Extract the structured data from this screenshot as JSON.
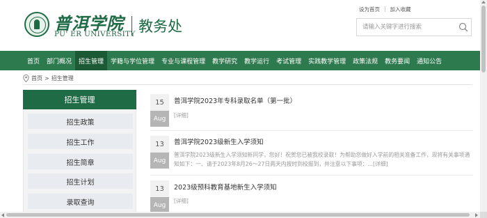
{
  "header": {
    "logo_cn": "普洱学院",
    "logo_en": "PU' ER UNIVERSITY",
    "department": "教务处",
    "logo_icon": "university-seal-icon",
    "top_links": [
      "设为首页",
      "加入收藏"
    ],
    "search_placeholder": "请输入关键字进行搜索",
    "search_icon": "search-icon"
  },
  "nav": {
    "items": [
      "首页",
      "部门概况",
      "招生管理",
      "学籍与学位管理",
      "专业与课程管理",
      "教学研究",
      "教学运行",
      "考试管理",
      "实践教学管理",
      "政策法规",
      "教务要闻",
      "通知公告"
    ],
    "active_index": 2
  },
  "breadcrumb": {
    "icon": "location-pin-icon",
    "home": "首页",
    "separator": ">",
    "current": "招生管理"
  },
  "sidebar": {
    "title": "招生管理",
    "items": [
      "招生政策",
      "招生工作",
      "招生简章",
      "招生计划",
      "录取查询"
    ]
  },
  "news": [
    {
      "day": "15",
      "month": "Aug",
      "title": "普洱学院2023年专科录取名单（第一批）",
      "detail": "[详细]"
    },
    {
      "day": "13",
      "month": "Aug",
      "title": "普洱学院2023级新生入学须知",
      "summary": "普洱学院2023级新生入学须知新同学，您好！祝贺您已被我校录取！为帮助您做好入学前的相关准备工作，现将有关事项通知如下：一、请于2023年8月26～27日两天内按时到校报到，并注意以下事项：...[详细]"
    },
    {
      "day": "13",
      "month": "Aug",
      "title": "2023级预科教育基地新生入学须知",
      "detail": "[详细]"
    }
  ],
  "colors": {
    "brand_green": "#1f6b45",
    "nav_green": "#2d7a4e",
    "nav_active": "#1c5a35",
    "date_month_bg": "#b5b5b5"
  }
}
